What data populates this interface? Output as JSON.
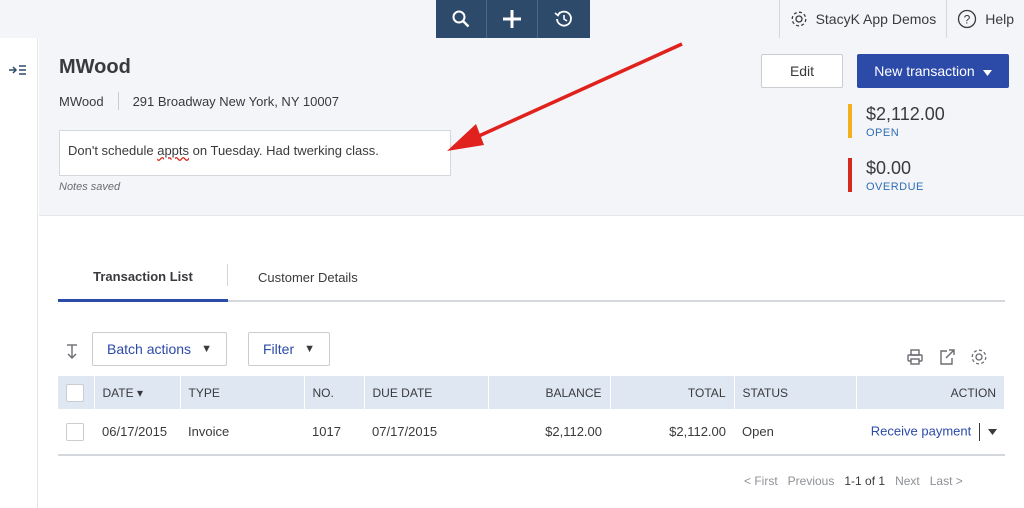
{
  "topbar": {
    "tools": [
      "search-icon",
      "plus-icon",
      "history-icon"
    ],
    "company_label": "StacyK App Demos",
    "help_label": "Help"
  },
  "customer": {
    "name": "MWood",
    "company": "MWood",
    "address": "291 Broadway New York, NY 10007",
    "note_pre": "Don't schedule ",
    "note_misspelled": "appts",
    "note_post": " on Tuesday. Had twerking class.",
    "notes_status": "Notes saved"
  },
  "header_actions": {
    "edit_label": "Edit",
    "new_transaction_label": "New transaction"
  },
  "summary": {
    "open_amount": "$2,112.00",
    "open_label": "OPEN",
    "overdue_amount": "$0.00",
    "overdue_label": "OVERDUE",
    "open_color": "#f2b01e",
    "overdue_color": "#d52b1e"
  },
  "tabs": {
    "transaction_list": "Transaction List",
    "customer_details": "Customer Details"
  },
  "toolbar": {
    "batch_actions": "Batch actions",
    "filter": "Filter"
  },
  "table": {
    "headers": {
      "date": "DATE ▾",
      "type": "TYPE",
      "no": "NO.",
      "due_date": "DUE DATE",
      "balance": "BALANCE",
      "total": "TOTAL",
      "status": "STATUS",
      "action": "ACTION"
    },
    "rows": [
      {
        "date": "06/17/2015",
        "type": "Invoice",
        "no": "1017",
        "due_date": "07/17/2015",
        "balance": "$2,112.00",
        "total": "$2,112.00",
        "status": "Open",
        "action": "Receive payment"
      }
    ]
  },
  "pagination": {
    "first": "< First",
    "previous": "Previous",
    "range": "1-1 of 1",
    "next": "Next",
    "last": "Last >"
  },
  "colors": {
    "primary": "#2c4aa8",
    "toolbar_dark": "#2e4a6b",
    "annotation_arrow": "#e0211d"
  }
}
